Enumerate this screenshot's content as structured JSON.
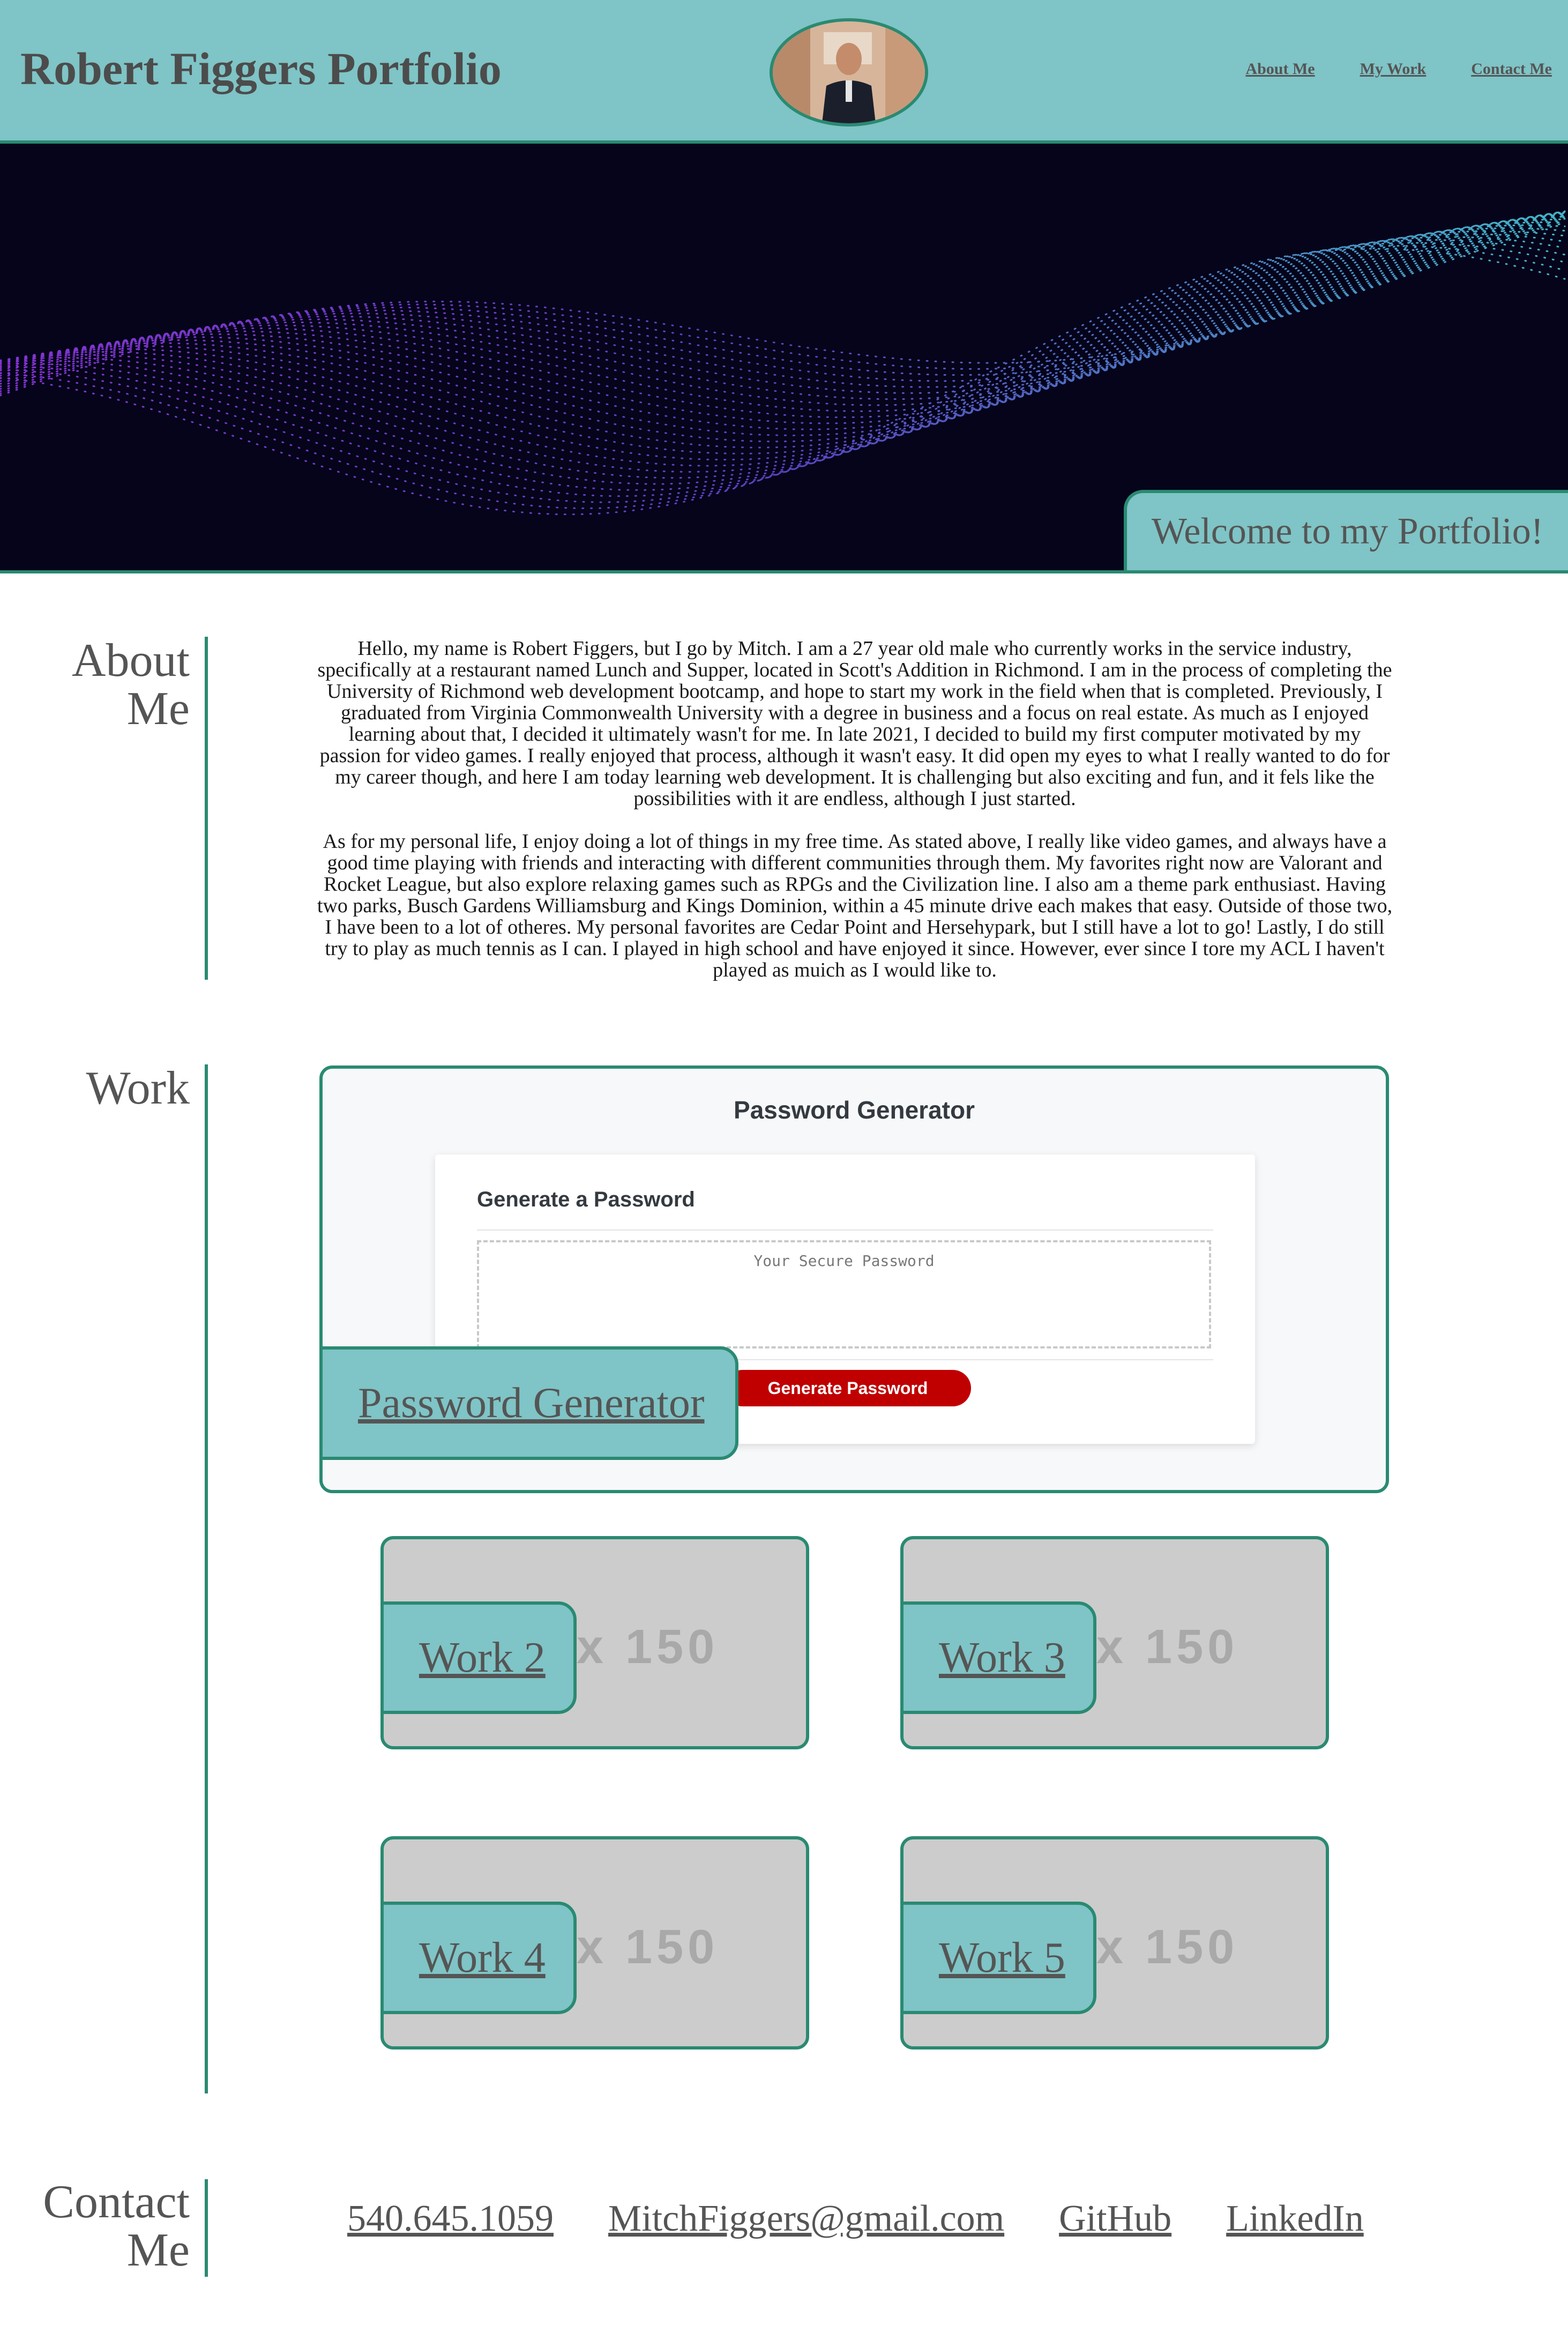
{
  "header": {
    "title": "Robert Figgers Portfolio",
    "nav": [
      "About Me",
      "My Work",
      "Contact Me"
    ]
  },
  "hero": {
    "welcome": "Welcome to my Portfolio!"
  },
  "about": {
    "heading": [
      "About",
      "Me"
    ],
    "paragraphs": [
      "Hello, my name is Robert Figgers, but I go by Mitch. I am a 27 year old male who currently works in the service industry, specifically at a restaurant named Lunch and Supper, located in Scott's Addition in Richmond. I am in the process of completing the University of Richmond web development bootcamp, and hope to start my work in the field when that is completed. Previously, I graduated from Virginia Commonwealth University with a degree in business and a focus on real estate. As much as I enjoyed learning about that, I decided it ultimately wasn't for me. In late 2021, I decided to build my first computer motivated by my passion for video games. I really enjoyed that process, although it wasn't easy. It did open my eyes to what I really wanted to do for my career though, and here I am today learning web development. It is challenging but also exciting and fun, and it fels like the possibilities with it are endless, although I just started.",
      "As for my personal life, I enjoy doing a lot of things in my free time. As stated above, I really like video games, and always have a good time playing with friends and interacting with different communities through them. My favorites right now are Valorant and Rocket League, but also explore relaxing games such as RPGs and the Civilization line. I also am a theme park enthusiast. Having two parks, Busch Gardens Williamsburg and Kings Dominion, within a 45 minute drive each makes that easy. Outside of those two, I have been to a lot of otheres. My personal favorites are Cedar Point and Hersehypark, but I still have a lot to go! Lastly, I do still try to play as much tennis as I can. I played in high school and have enjoyed it since. However, ever since I tore my ACL I haven't played as muich as I would like to."
    ]
  },
  "work": {
    "heading": "Work",
    "featured": {
      "label": "Password Generator",
      "app_title": "Password Generator",
      "card_title": "Generate a Password",
      "textarea_placeholder": "Your Secure Password",
      "button": "Generate Password"
    },
    "projects": [
      {
        "label": "Work 2",
        "placeholder": "x 150"
      },
      {
        "label": "Work 3",
        "placeholder": "x 150"
      },
      {
        "label": "Work 4",
        "placeholder": "x 150"
      },
      {
        "label": "Work 5",
        "placeholder": "x 150"
      }
    ]
  },
  "contact": {
    "heading": [
      "Contact",
      "Me"
    ],
    "links": [
      "540.645.1059",
      "MitchFiggers@gmail.com",
      "GitHub",
      "LinkedIn"
    ]
  },
  "colors": {
    "accent": "#7fc4c6",
    "border": "#2a8a72",
    "button": "#c00000"
  }
}
